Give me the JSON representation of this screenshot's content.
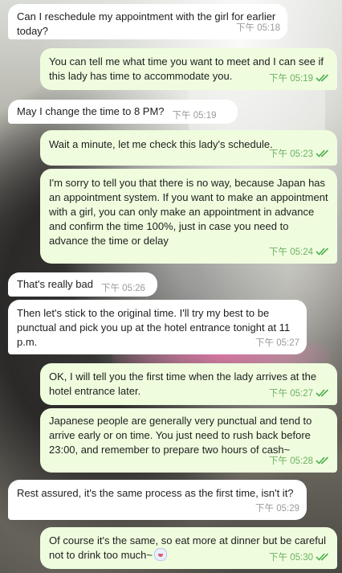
{
  "messages": [
    {
      "dir": "in",
      "text": "Can I reschedule my appointment with the girl for earlier today?",
      "time": "下午 05:18"
    },
    {
      "dir": "out",
      "text": "You can tell me what time you want to meet and I can see if this lady has time to accommodate you.",
      "time": "下午 05:19"
    },
    {
      "dir": "in",
      "text": "May I change the time to 8 PM?",
      "time": "下午 05:19"
    },
    {
      "dir": "out",
      "text": "Wait a minute, let me check this lady's schedule.",
      "time": "下午 05:23"
    },
    {
      "dir": "out",
      "text": "I'm sorry to tell you that there is no way, because Japan has an appointment system. If you want to make an appointment with a girl, you can only make an appointment in advance and confirm the time 100%, just in case you need to advance the time or delay",
      "time": "下午 05:24"
    },
    {
      "dir": "in",
      "text": "That's really bad",
      "time": "下午 05:26"
    },
    {
      "dir": "in",
      "text": "Then let's stick to the original time. I'll try my best to be punctual and pick you up at the hotel entrance tonight at 11 p.m.",
      "time": "下午 05:27"
    },
    {
      "dir": "out",
      "text": "OK, I will tell you the first time when the lady arrives at the hotel entrance later.",
      "time": "下午 05:27"
    },
    {
      "dir": "out",
      "text": "Japanese people are generally very punctual and tend to arrive early or on time. You just need to rush back before 23:00, and remember to prepare two hours of cash~",
      "time": "下午 05:28"
    },
    {
      "dir": "in",
      "text": "Rest assured, it's the same process as the first time, isn't it?",
      "time": "下午 05:29"
    },
    {
      "dir": "out",
      "text": "Of course it's the same, so eat more at dinner but be careful not to drink too much~",
      "time": "下午 05:30"
    }
  ],
  "icons": {
    "read_receipt": "double-check-icon",
    "emoji": "cold-sweat-emoji-icon"
  },
  "colors": {
    "incoming_bubble": "#ffffff",
    "outgoing_bubble": "#effdde",
    "outgoing_meta": "#6db064"
  }
}
